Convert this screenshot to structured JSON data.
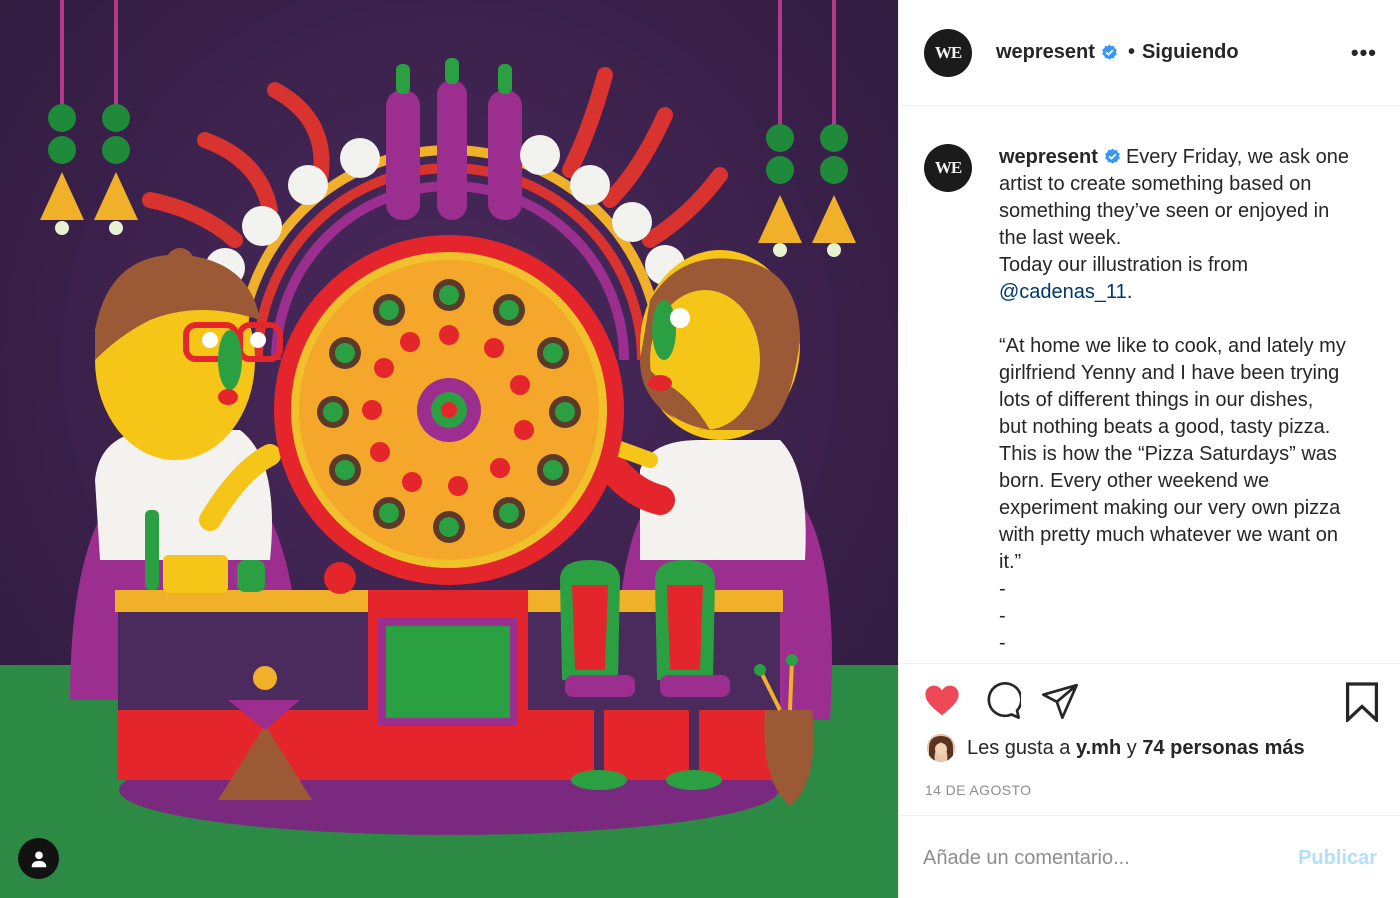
{
  "post": {
    "username": "wepresent",
    "follow_status": "Siguiendo",
    "avatar_logo": "WE",
    "more_icon": "more-horizontal-icon"
  },
  "caption": {
    "username": "wepresent",
    "lines": [
      "Every Friday, we ask one",
      "artist to create something based on",
      "something they’ve seen or enjoyed in",
      "the last week.",
      "Today our illustration is from"
    ],
    "mention": "@cadenas_11",
    "mention_suffix": ".",
    "quote_lines": [
      "“At home we like to cook, and lately my",
      "girlfriend Yenny and I have been trying",
      "lots of different things in our dishes,",
      "but nothing beats a good, tasty pizza.",
      "This is how the “Pizza Saturdays” was",
      "born. Every other weekend we",
      "experiment making our very own pizza",
      "with pretty much whatever we want on",
      "it.”",
      "-",
      "-",
      "-"
    ]
  },
  "actions": {
    "like_icon": "heart-filled-icon",
    "comment_icon": "comment-icon",
    "share_icon": "send-icon",
    "save_icon": "bookmark-icon",
    "like_color": "#ed4956"
  },
  "likes": {
    "prefix": "Les gusta a",
    "user": "y.mh",
    "connector": "y",
    "others": "74 personas más"
  },
  "date": "14 DE AGOSTO",
  "comment": {
    "placeholder": "Añade un comentario...",
    "publish_label": "Publicar"
  },
  "colors": {
    "verified": "#3897f0",
    "link": "#00376b",
    "publish_disabled": "#b2dffc",
    "muted": "#8e8e8e"
  }
}
